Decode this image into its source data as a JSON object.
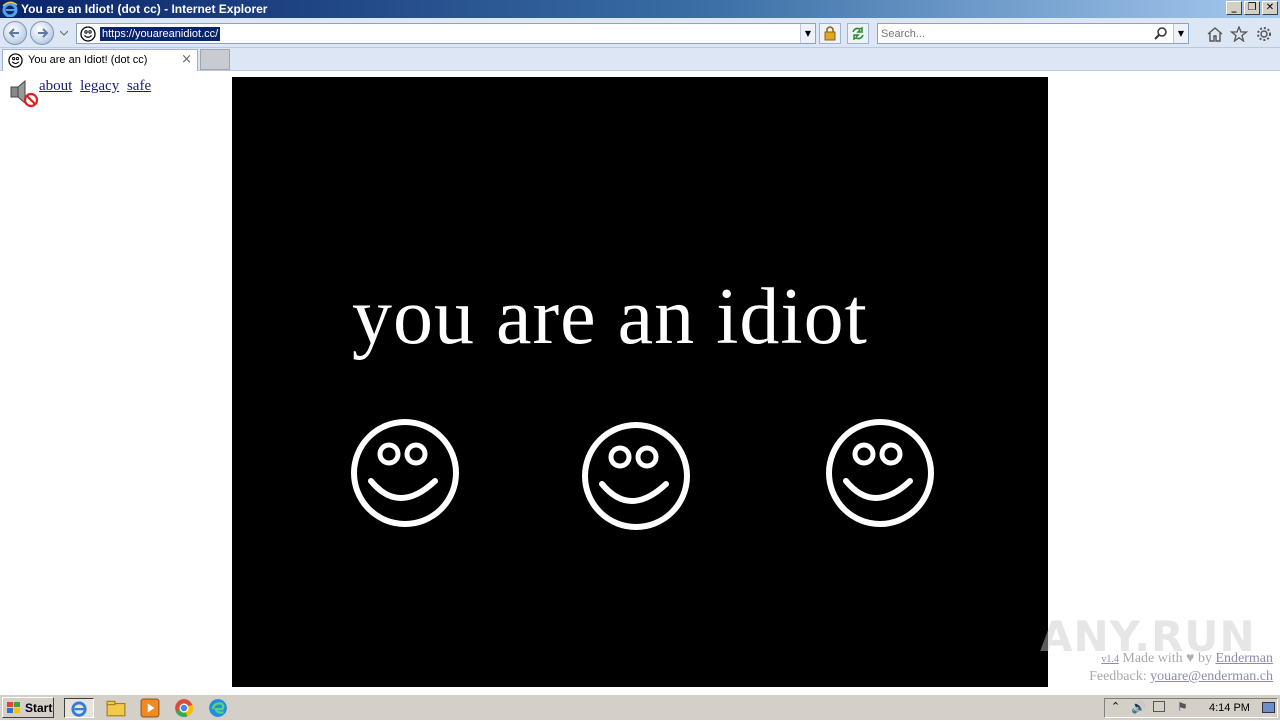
{
  "window": {
    "title": "You are an Idiot! (dot cc) - Internet Explorer"
  },
  "navbar": {
    "url": "https://youareanidiot.cc/",
    "search_placeholder": "Search..."
  },
  "tabs": [
    {
      "label": "You are an Idiot! (dot cc)"
    }
  ],
  "page": {
    "links": [
      "about",
      "legacy",
      "safe"
    ],
    "headline": "you are an idiot",
    "footer": {
      "version": "v1.4",
      "made_with": "Made with",
      "by": "by",
      "author": "Enderman",
      "feedback_label": "Feedback:",
      "feedback_email": "youare@enderman.ch"
    },
    "watermark": "ANY.RUN",
    "stage_color": "#000000",
    "text_color": "#ffffff"
  },
  "taskbar": {
    "start_label": "Start",
    "clock": "4:14 PM"
  },
  "icons": [
    "ie-logo",
    "back-arrow-icon",
    "forward-arrow-icon",
    "smiley-site-icon",
    "lock-icon",
    "refresh-icon",
    "search-icon",
    "home-icon",
    "favorites-star-icon",
    "gear-icon",
    "speaker-muted-icon",
    "smiley-face-icon"
  ]
}
